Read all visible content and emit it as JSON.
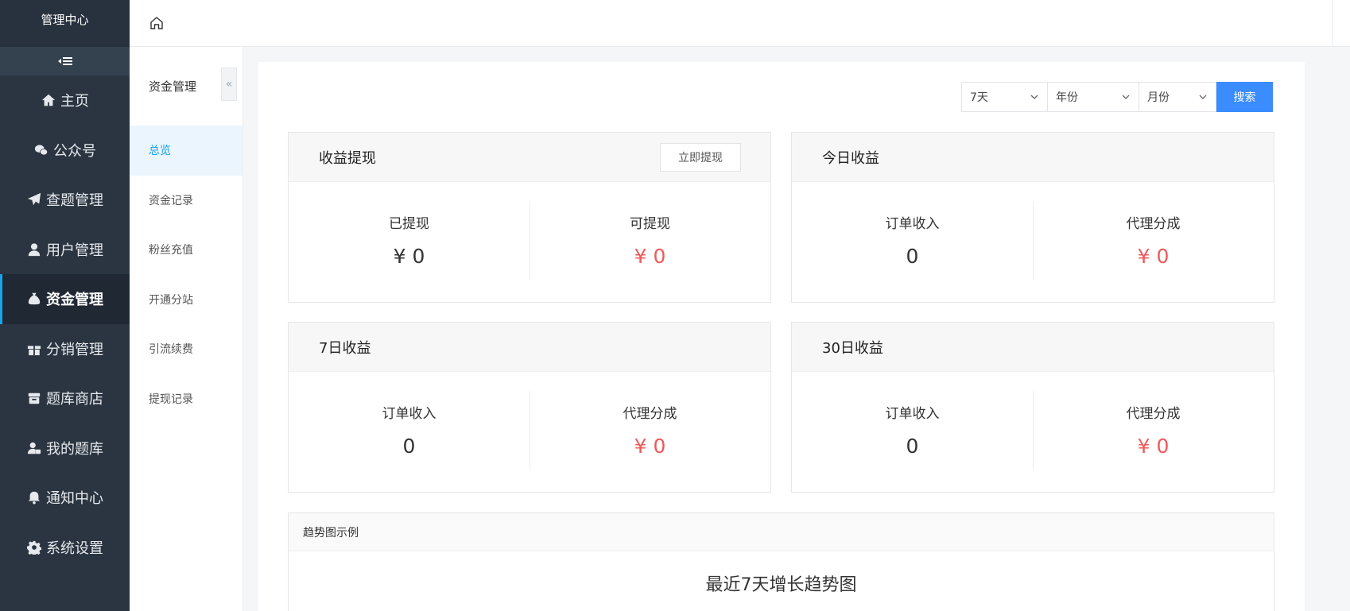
{
  "sidebar": {
    "brand": "管理中心",
    "items": [
      {
        "label": "主页",
        "icon": "home-icon"
      },
      {
        "label": "公众号",
        "icon": "wechat-icon"
      },
      {
        "label": "查题管理",
        "icon": "paper-plane-icon"
      },
      {
        "label": "用户管理",
        "icon": "user-icon"
      },
      {
        "label": "资金管理",
        "icon": "money-bag-icon",
        "active": true
      },
      {
        "label": "分销管理",
        "icon": "gift-icon"
      },
      {
        "label": "题库商店",
        "icon": "store-icon"
      },
      {
        "label": "我的题库",
        "icon": "user-lock-icon"
      },
      {
        "label": "通知中心",
        "icon": "bell-icon"
      },
      {
        "label": "系统设置",
        "icon": "gear-icon"
      }
    ]
  },
  "subnav": {
    "title": "资金管理",
    "items": [
      {
        "label": "总览",
        "active": true
      },
      {
        "label": "资金记录"
      },
      {
        "label": "粉丝充值"
      },
      {
        "label": "开通分站"
      },
      {
        "label": "引流续费"
      },
      {
        "label": "提现记录"
      }
    ]
  },
  "filters": {
    "days": "7天",
    "year": "年份",
    "month": "月份",
    "search_label": "搜索"
  },
  "cards": {
    "withdraw": {
      "title": "收益提现",
      "button": "立即提现",
      "stats": [
        {
          "label": "已提现",
          "value": "¥ 0"
        },
        {
          "label": "可提现",
          "value": "¥ 0"
        }
      ]
    },
    "today": {
      "title": "今日收益",
      "stats": [
        {
          "label": "订单收入",
          "value": "0"
        },
        {
          "label": "代理分成",
          "value": "¥ 0"
        }
      ]
    },
    "seven": {
      "title": "7日收益",
      "stats": [
        {
          "label": "订单收入",
          "value": "0"
        },
        {
          "label": "代理分成",
          "value": "¥ 0"
        }
      ]
    },
    "thirty": {
      "title": "30日收益",
      "stats": [
        {
          "label": "订单收入",
          "value": "0"
        },
        {
          "label": "代理分成",
          "value": "¥ 0"
        }
      ]
    }
  },
  "trend": {
    "header": "趋势图示例",
    "title": "最近7天增长趋势图"
  },
  "colors": {
    "sidebar_bg": "#2b3541",
    "accent": "#1aa3e8",
    "primary_button": "#3a8cff",
    "money_red": "#f0595a"
  }
}
